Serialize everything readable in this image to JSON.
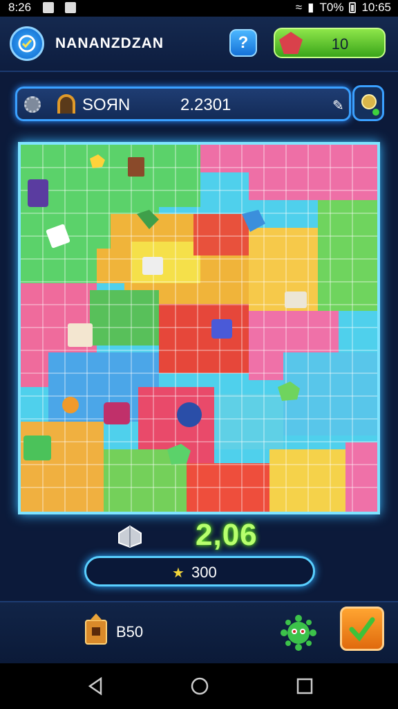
{
  "status_bar": {
    "time": "8:26",
    "battery": "T0%",
    "clock": "10:65"
  },
  "header": {
    "app_name": "NANANZDZAN",
    "help_label": "?",
    "energy_value": "10"
  },
  "info_bar": {
    "label": "SOЯN",
    "score": "2.2301"
  },
  "stats": {
    "big_score": "2,06",
    "progress_value": "300",
    "chest_count": "B50"
  },
  "colors": {
    "accent_cyan": "#7fe4ff",
    "score_green": "#b8ff6e",
    "energy_green": "#3aa51a",
    "action_orange": "#e06a0d"
  },
  "icons": [
    "target-logo-icon",
    "help-icon",
    "gem-icon",
    "gear-icon",
    "arch-icon",
    "pencil-icon",
    "coin-icon",
    "pieces-icon",
    "star-icon",
    "chest-icon",
    "virus-icon",
    "checkmark-icon",
    "back-icon",
    "home-icon",
    "recents-icon"
  ]
}
